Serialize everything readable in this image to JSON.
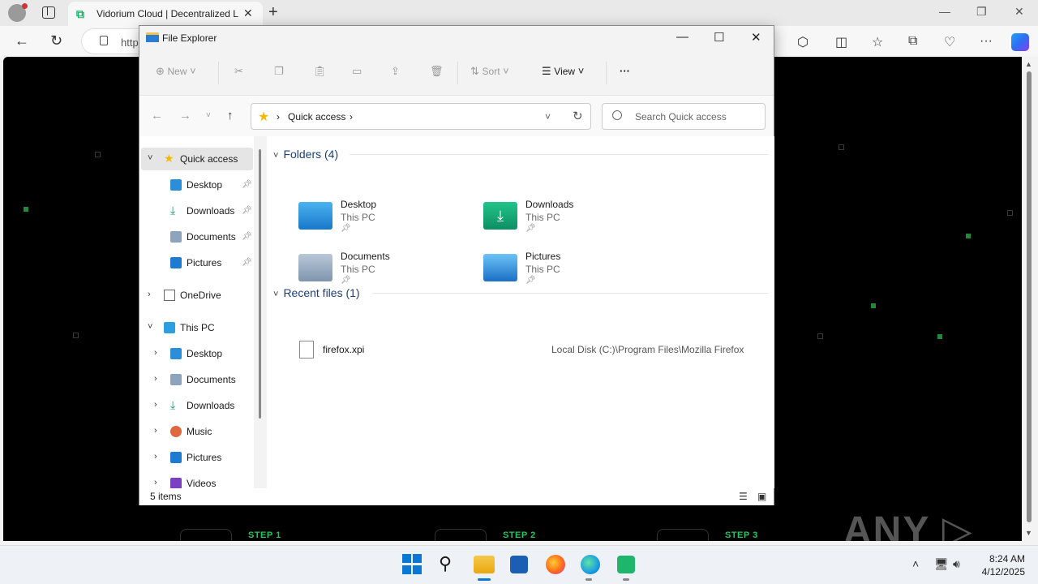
{
  "browser": {
    "tab_title": "Vidorium Cloud | Decentralized L",
    "url_prefix": "http",
    "minimize": "—",
    "restore": "❐",
    "close": "✕"
  },
  "explorer": {
    "title": "File Explorer",
    "toolbar": {
      "new_label": "New",
      "sort_label": "Sort",
      "view_label": "View",
      "more": "···"
    },
    "address": {
      "crumb": "Quick access"
    },
    "search_placeholder": "Search Quick access",
    "sidebar": [
      {
        "label": "Quick access",
        "icon": "star-icon"
      },
      {
        "label": "Desktop",
        "icon": "desktop-icon"
      },
      {
        "label": "Downloads",
        "icon": "download-icon"
      },
      {
        "label": "Documents",
        "icon": "documents-icon"
      },
      {
        "label": "Pictures",
        "icon": "pictures-icon"
      },
      {
        "label": "OneDrive",
        "icon": "onedrive-icon"
      },
      {
        "label": "This PC",
        "icon": "pc-icon"
      },
      {
        "label": "Desktop",
        "icon": "desktop-icon"
      },
      {
        "label": "Documents",
        "icon": "documents-icon"
      },
      {
        "label": "Downloads",
        "icon": "download-icon"
      },
      {
        "label": "Music",
        "icon": "music-icon"
      },
      {
        "label": "Pictures",
        "icon": "pictures-icon"
      },
      {
        "label": "Videos",
        "icon": "videos-icon"
      }
    ],
    "folders_header": "Folders (4)",
    "folders": [
      {
        "name": "Desktop",
        "location": "This PC"
      },
      {
        "name": "Downloads",
        "location": "This PC"
      },
      {
        "name": "Documents",
        "location": "This PC"
      },
      {
        "name": "Pictures",
        "location": "This PC"
      }
    ],
    "recent_header": "Recent files (1)",
    "recent": [
      {
        "name": "firefox.xpi",
        "path": "Local Disk (C:)\\Program Files\\Mozilla Firefox"
      }
    ],
    "status": "5 items"
  },
  "page": {
    "steps": [
      "STEP 1",
      "STEP 2",
      "STEP 3"
    ],
    "watermark": "ANY ▷ RUN"
  },
  "taskbar": {
    "time": "8:24 AM",
    "date": "4/12/2025"
  },
  "colors": {
    "accent": "#0a78d4",
    "step_green": "#22c55e",
    "page_bg": "#000000"
  }
}
